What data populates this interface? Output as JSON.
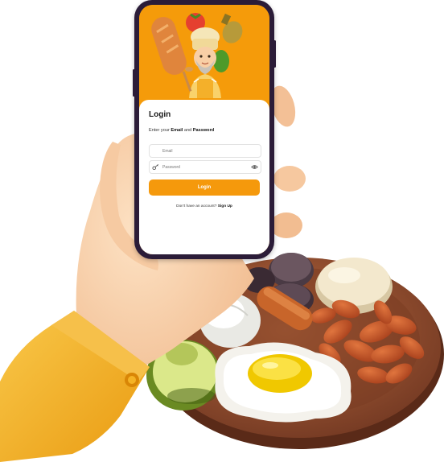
{
  "login": {
    "title": "Login",
    "subtitle_prefix": "Enter your ",
    "subtitle_email": "Email",
    "subtitle_and": " and ",
    "subtitle_password": "Password",
    "email_placeholder": "Email",
    "password_placeholder": "Password",
    "button_label": "Login",
    "no_account_text": "Don't have an account? ",
    "signup_label": "Sign Up"
  },
  "colors": {
    "brand_orange": "#f5990c",
    "phone_frame": "#2b1c38",
    "sleeve_yellow": "#f4b21a",
    "plate_brown": "#8a4a2c"
  },
  "icons": {
    "password_field_icon": "key-icon",
    "password_toggle_icon": "eye-icon"
  }
}
